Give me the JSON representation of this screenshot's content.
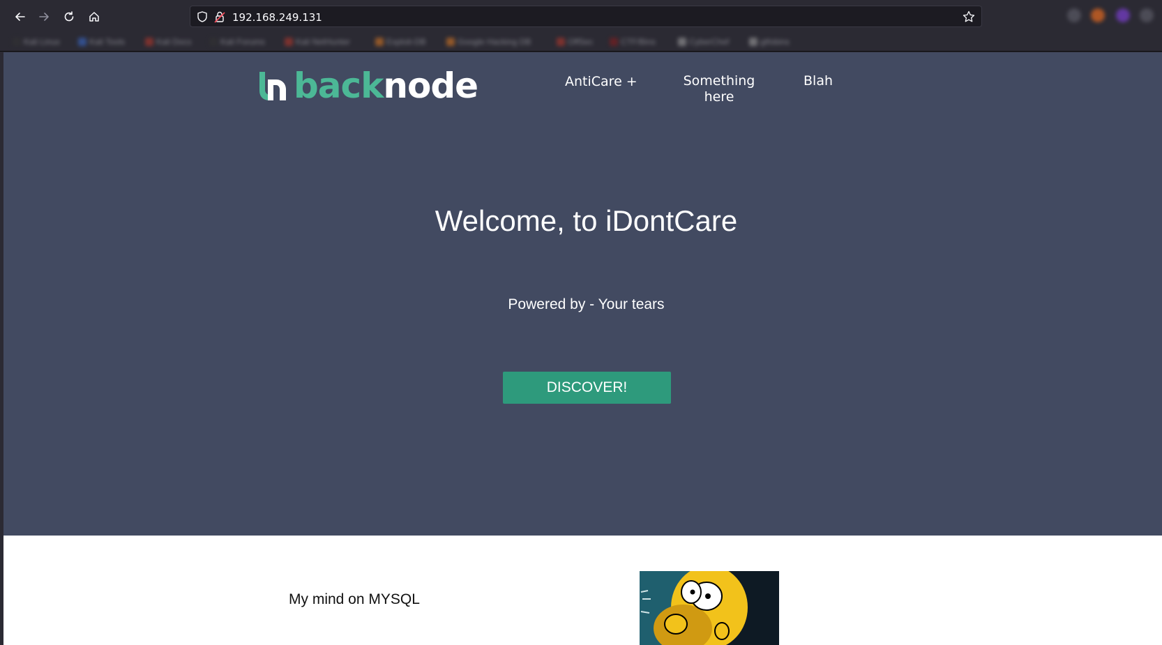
{
  "browser": {
    "url": "192.168.249.131",
    "bookmarks": [
      "Kali Linux",
      "Kali Tools",
      "Kali Docs",
      "Kali Forums",
      "Kali NetHunter",
      "Exploit-DB",
      "Google Hacking DB",
      "OffSec",
      "CTF/Bins",
      "CyberChef",
      "gtfobins"
    ]
  },
  "site": {
    "logo": {
      "part1": "back",
      "part2": "node"
    },
    "nav": {
      "item1": "AntiCare +",
      "item2_line1": "Something",
      "item2_line2": "here",
      "item3": "Blah"
    },
    "hero": {
      "title": "Welcome, to iDontCare",
      "subtitle": "Powered by - Your tears",
      "button": "DISCOVER!"
    },
    "section": {
      "text": "My mind on MYSQL"
    }
  },
  "colors": {
    "hero_bg": "#424a61",
    "accent": "#4cb896",
    "button": "#2e9a7c"
  }
}
